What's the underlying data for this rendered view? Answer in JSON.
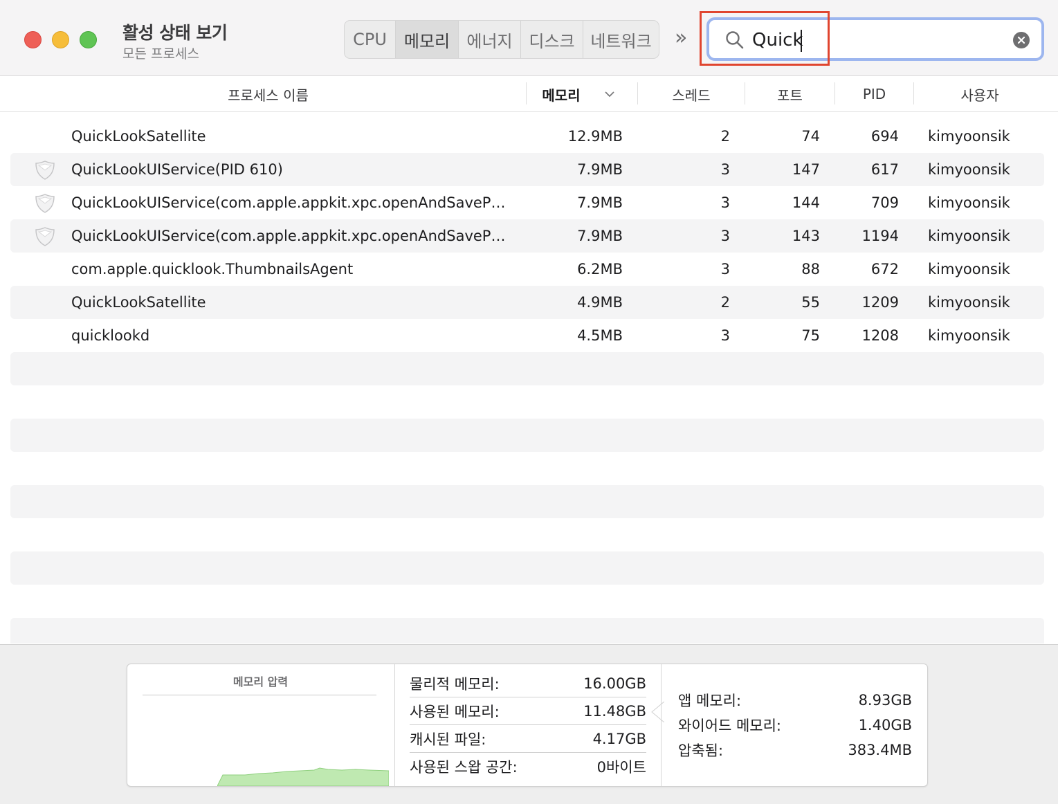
{
  "app": {
    "title": "활성 상태 보기",
    "subtitle": "모든 프로세스"
  },
  "tabs": [
    "CPU",
    "메모리",
    "에너지",
    "디스크",
    "네트워크"
  ],
  "active_tab": "메모리",
  "search": {
    "value": "Quick",
    "placeholder": ""
  },
  "columns": {
    "name": "프로세스 이름",
    "memory": "메모리",
    "threads": "스레드",
    "ports": "포트",
    "pid": "PID",
    "user": "사용자"
  },
  "sort": {
    "column": "메모리",
    "direction": "descending"
  },
  "rows": [
    {
      "name": "QuickLookSatellite",
      "memory": "12.9MB",
      "threads": "2",
      "ports": "74",
      "pid": "694",
      "user": "kimyoonsik",
      "icon": ""
    },
    {
      "name": "QuickLookUIService(PID 610)",
      "memory": "7.9MB",
      "threads": "3",
      "ports": "147",
      "pid": "617",
      "user": "kimyoonsik",
      "icon": "shield-icon"
    },
    {
      "name": "QuickLookUIService(com.apple.appkit.xpc.openAndSaveP…",
      "memory": "7.9MB",
      "threads": "3",
      "ports": "144",
      "pid": "709",
      "user": "kimyoonsik",
      "icon": "shield-icon"
    },
    {
      "name": "QuickLookUIService(com.apple.appkit.xpc.openAndSaveP…",
      "memory": "7.9MB",
      "threads": "3",
      "ports": "143",
      "pid": "1194",
      "user": "kimyoonsik",
      "icon": "shield-icon"
    },
    {
      "name": "com.apple.quicklook.ThumbnailsAgent",
      "memory": "6.2MB",
      "threads": "3",
      "ports": "88",
      "pid": "672",
      "user": "kimyoonsik",
      "icon": ""
    },
    {
      "name": "QuickLookSatellite",
      "memory": "4.9MB",
      "threads": "2",
      "ports": "55",
      "pid": "1209",
      "user": "kimyoonsik",
      "icon": ""
    },
    {
      "name": "quicklookd",
      "memory": "4.5MB",
      "threads": "3",
      "ports": "75",
      "pid": "1208",
      "user": "kimyoonsik",
      "icon": ""
    }
  ],
  "memory_panel": {
    "pressure_title": "메모리 압력",
    "pressure_color": "#bfe9b1",
    "stats": [
      {
        "label": "물리적 메모리:",
        "value": "16.00GB"
      },
      {
        "label": "사용된 메모리:",
        "value": "11.48GB"
      },
      {
        "label": "캐시된 파일:",
        "value": "4.17GB"
      },
      {
        "label": "사용된 스왑 공간:",
        "value": "0바이트"
      }
    ],
    "breakdown": [
      {
        "label": "앱 메모리:",
        "value": "8.93GB"
      },
      {
        "label": "와이어드 메모리:",
        "value": "1.40GB"
      },
      {
        "label": "압축됨:",
        "value": "383.4MB"
      }
    ]
  },
  "colors": {
    "highlight": "#e0452f",
    "search_focus": "#9db6ef",
    "alt_row": "#f4f4f5"
  }
}
